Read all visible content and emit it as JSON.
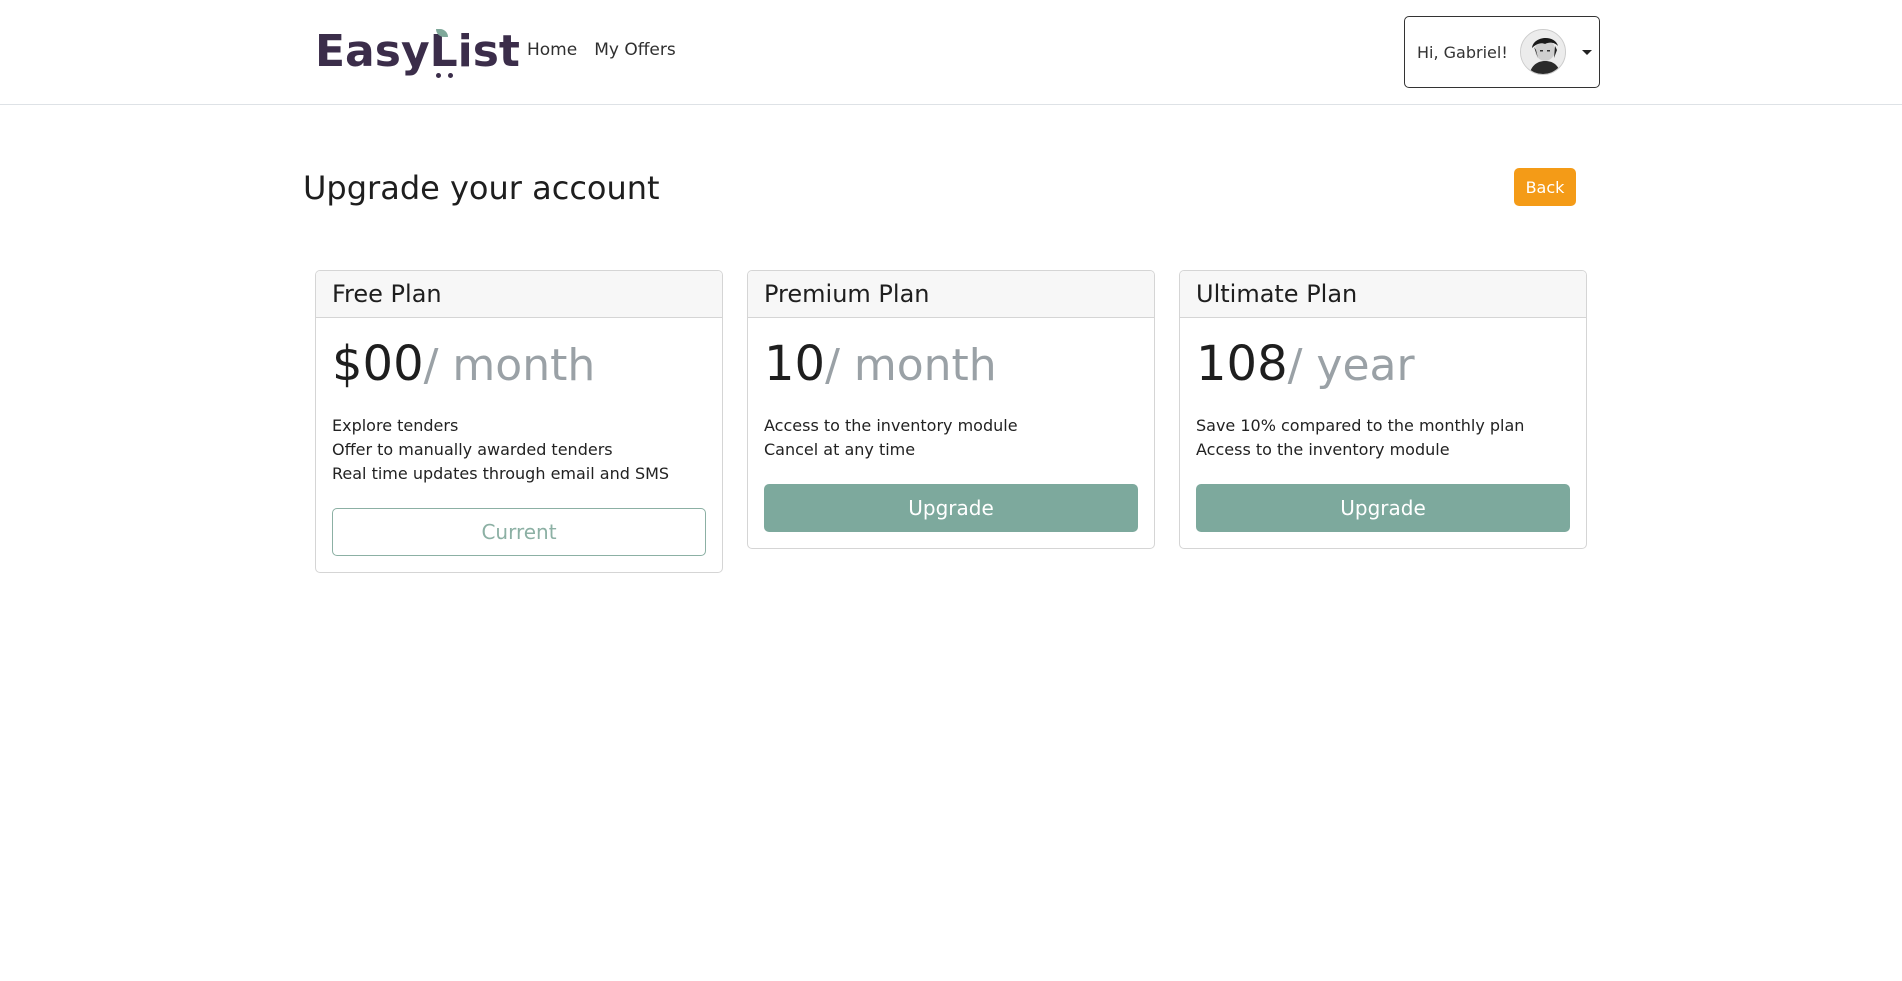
{
  "header": {
    "logo": {
      "part1": "Easy",
      "part2": "List"
    },
    "nav": [
      {
        "label": "Home"
      },
      {
        "label": "My Offers"
      }
    ],
    "user": {
      "greeting": "Hi, Gabriel!"
    }
  },
  "page": {
    "title": "Upgrade your account",
    "back_label": "Back"
  },
  "plans": [
    {
      "name": "Free Plan",
      "price": "$00",
      "period": "/ month",
      "features": [
        "Explore tenders",
        "Offer to manually awarded tenders",
        "Real time updates through email and SMS"
      ],
      "button_label": "Current"
    },
    {
      "name": "Premium Plan",
      "price": "10",
      "period": "/ month",
      "features": [
        "Access to the inventory module",
        "Cancel at any time"
      ],
      "button_label": "Upgrade"
    },
    {
      "name": "Ultimate Plan",
      "price": "108",
      "period": "/ year",
      "features": [
        "Save 10% compared to the monthly plan",
        "Access to the inventory module"
      ],
      "button_label": "Upgrade"
    }
  ],
  "colors": {
    "logo": "#3b2d4a",
    "accent_green": "#7da99d",
    "back_button": "#f49b17"
  }
}
